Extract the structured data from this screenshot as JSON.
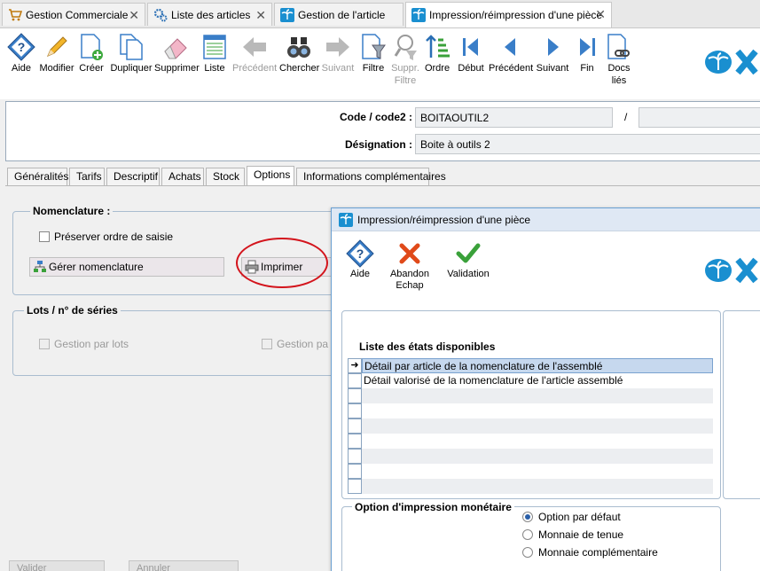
{
  "window_tabs": [
    {
      "label": "Gestion Commerciale",
      "icon": "cart-icon"
    },
    {
      "label": "Liste des articles",
      "icon": "gears-icon"
    },
    {
      "label": "Gestion de l'article",
      "icon": "palm-icon"
    },
    {
      "label": "Impression/réimpression d'une pièce",
      "icon": "palm-icon"
    }
  ],
  "toolbar": {
    "aide": "Aide",
    "modifier": "Modifier",
    "creer": "Créer",
    "dupliquer": "Dupliquer",
    "supprimer": "Supprimer",
    "liste": "Liste",
    "precedent": "Précédent",
    "chercher": "Chercher",
    "suivant": "Suivant",
    "filtre": "Filtre",
    "suppr_filtre_1": "Suppr.",
    "suppr_filtre_2": "Filtre",
    "ordre": "Ordre",
    "debut": "Début",
    "precedent2": "Précédent",
    "suivant2": "Suivant",
    "fin": "Fin",
    "docs_1": "Docs",
    "docs_2": "liés"
  },
  "header": {
    "code_label": "Code / code2 :",
    "code_value": "BOITAOUTIL2",
    "separator": "/",
    "code2_value": "",
    "designation_label": "Désignation :",
    "designation_value": "Boite à outils 2"
  },
  "content_tabs": [
    "Généralités",
    "Tarifs",
    "Descriptif",
    "Achats",
    "Stock",
    "Options",
    "Informations complémentaires"
  ],
  "nomenclature": {
    "title": "Nomenclature :",
    "preserve_label": "Préserver ordre de saisie",
    "gerer_label": "Gérer nomenclature",
    "imprimer_label": "Imprimer"
  },
  "lots": {
    "title": "Lots / n° de séries",
    "gestion_lots": "Gestion par lots",
    "gestion_pa": "Gestion pa"
  },
  "bottom": {
    "valider": "Valider",
    "annuler": "Annuler"
  },
  "modal": {
    "title": "Impression/réimpression d'une pièce",
    "aide": "Aide",
    "abandon_1": "Abandon",
    "abandon_2": "Echap",
    "validation": "Validation",
    "list_title": "Liste des états disponibles",
    "rows": [
      "Détail par article de la nomenclature de l'assemblé",
      "Détail valorisé de la nomenclature de l'article assemblé",
      "",
      "",
      "",
      "",
      "",
      "",
      ""
    ],
    "option_title": "Option d'impression monétaire",
    "options": [
      "Option par défaut",
      "Monnaie de tenue",
      "Monnaie complémentaire"
    ]
  },
  "colors": {
    "accent": "#1a8fd0",
    "highlight_circle": "#d3141c"
  }
}
